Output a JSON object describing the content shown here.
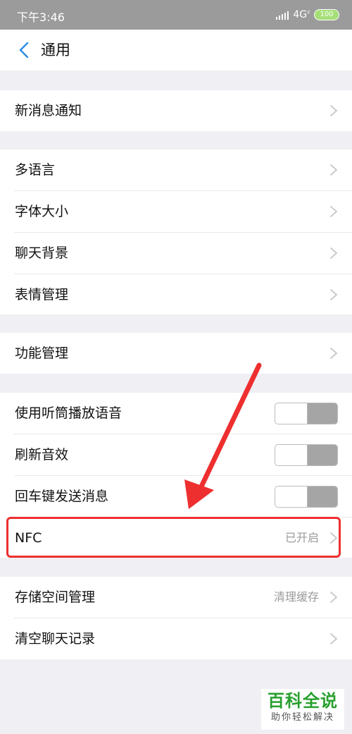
{
  "status_bar": {
    "time": "下午3:46",
    "network": "4G",
    "network_sub": "ıl",
    "battery": "100",
    "battery_color": "#a6df78"
  },
  "nav": {
    "back_icon": "chevron-left-icon",
    "title": "通用",
    "accent_color": "#2a8ce6"
  },
  "groups": [
    {
      "rows": [
        {
          "label": "新消息通知",
          "type": "link"
        }
      ]
    },
    {
      "rows": [
        {
          "label": "多语言",
          "type": "link"
        },
        {
          "label": "字体大小",
          "type": "link"
        },
        {
          "label": "聊天背景",
          "type": "link"
        },
        {
          "label": "表情管理",
          "type": "link"
        }
      ]
    },
    {
      "rows": [
        {
          "label": "功能管理",
          "type": "link"
        }
      ]
    },
    {
      "rows": [
        {
          "label": "使用听筒播放语音",
          "type": "toggle",
          "on": false
        },
        {
          "label": "刷新音效",
          "type": "toggle",
          "on": false
        },
        {
          "label": "回车键发送消息",
          "type": "toggle",
          "on": false
        },
        {
          "label": "NFC",
          "type": "link",
          "value": "已开启"
        }
      ]
    },
    {
      "rows": [
        {
          "label": "存储空间管理",
          "type": "link",
          "value": "清理缓存"
        },
        {
          "label": "清空聊天记录",
          "type": "link"
        }
      ]
    }
  ],
  "annotation": {
    "color": "#ee2f2f"
  },
  "watermark": {
    "main": "百科全说",
    "sub": "助你轻松解决",
    "color": "#28a02f"
  }
}
